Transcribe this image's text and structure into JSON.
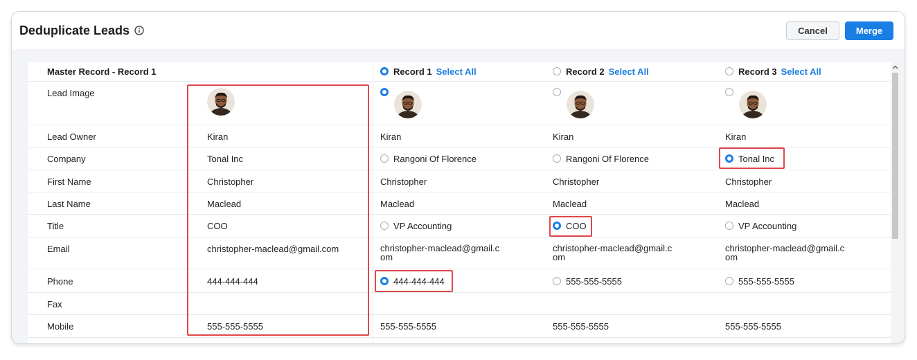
{
  "header": {
    "title": "Deduplicate Leads",
    "cancel_label": "Cancel",
    "merge_label": "Merge"
  },
  "columns": {
    "master": "Master Record - Record 1",
    "records": [
      {
        "name": "Record 1",
        "select_all": "Select All",
        "selected": true
      },
      {
        "name": "Record 2",
        "select_all": "Select All",
        "selected": false
      },
      {
        "name": "Record 3",
        "select_all": "Select All",
        "selected": false
      }
    ]
  },
  "rows": [
    {
      "label": "Lead Image",
      "master": "",
      "values": [
        "",
        "",
        ""
      ]
    },
    {
      "label": "Lead Owner",
      "master": "Kiran",
      "values": [
        "Kiran",
        "Kiran",
        "Kiran"
      ]
    },
    {
      "label": "Company",
      "master": "Tonal Inc",
      "values": [
        "Rangoni Of Florence",
        "Rangoni Of Florence",
        "Tonal Inc"
      ]
    },
    {
      "label": "First Name",
      "master": "Christopher",
      "values": [
        "Christopher",
        "Christopher",
        "Christopher"
      ]
    },
    {
      "label": "Last Name",
      "master": "Maclead",
      "values": [
        "Maclead",
        "Maclead",
        "Maclead"
      ]
    },
    {
      "label": "Title",
      "master": "COO",
      "values": [
        "VP Accounting",
        "COO",
        "VP Accounting"
      ]
    },
    {
      "label": "Email",
      "master": "christopher-maclead@gmail.com",
      "values": [
        {
          "line1": "christopher-maclead@gmail.c",
          "line2": "om"
        },
        {
          "line1": "christopher-maclead@gmail.c",
          "line2": "om"
        },
        {
          "line1": "christopher-maclead@gmail.c",
          "line2": "om"
        }
      ]
    },
    {
      "label": "Phone",
      "master": "444-444-444",
      "values": [
        "444-444-444",
        "555-555-5555",
        "555-555-5555"
      ]
    },
    {
      "label": "Fax",
      "master": "",
      "values": [
        "",
        "",
        ""
      ]
    },
    {
      "label": "Mobile",
      "master": "555-555-5555",
      "values": [
        "555-555-5555",
        "555-555-5555",
        "555-555-5555"
      ]
    }
  ],
  "colors": {
    "accent": "#1a7fe4",
    "highlight": "#e0474b"
  },
  "icons": {
    "info": "info-icon",
    "radio": "radio-icon",
    "avatar": "avatar-icon",
    "scroll_up": "chevron-up-icon"
  }
}
